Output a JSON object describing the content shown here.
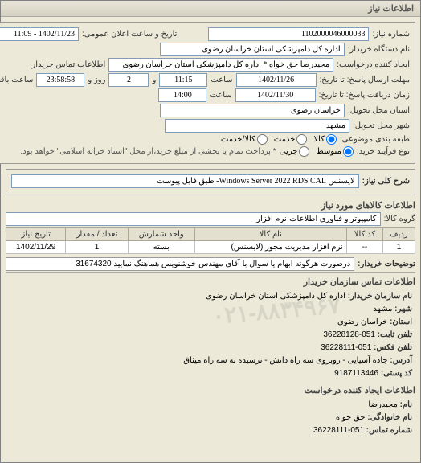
{
  "window_title": "اطلاعات نیاز",
  "fields": {
    "need_no_lbl": "شماره نیاز:",
    "need_no": "1102000046000033",
    "announce_lbl": "تاریخ و ساعت اعلان عمومی:",
    "announce_val": "1402/11/23 - 11:09",
    "buyer_org_lbl": "نام دستگاه خریدار:",
    "buyer_org": "اداره کل دامپزشکی استان خراسان رضوی",
    "creator_lbl": "ایجاد کننده درخواست:",
    "creator": "مجیدرضا حق خواه * اداره کل دامپزشکی استان خراسان رضوی",
    "contact_link": "اطلاعات تماس خریدار",
    "deadline_send_lbl": "مهلت ارسال پاسخ: تا تاریخ:",
    "deadline_date": "1402/11/26",
    "time_lbl": "ساعت",
    "deadline_time": "11:15",
    "and_lbl": "و",
    "days_remain": "2",
    "days_lbl": "روز و",
    "hms_remain": "23:58:58",
    "remain_lbl": "ساعت باقی مانده",
    "receive_lbl": "زمان دریافت پاسخ: تا تاریخ:",
    "receive_date": "1402/11/30",
    "receive_time": "14:00",
    "province_lbl": "استان محل تحویل:",
    "province": "خراسان رضوی",
    "city_lbl": "شهر محل تحویل:",
    "city": "مشهد",
    "category_lbl": "طبقه بندی موضوعی:",
    "cat_opts": {
      "goods": "کالا",
      "service": "خدمت",
      "both": "کالا/خدمت"
    },
    "purchase_type_lbl": "نوع فرآیند خرید:",
    "pt_opts": {
      "medium": "متوسط",
      "minor": "جزیی"
    },
    "purchase_note": "* پرداخت تمام یا بخشی از مبلغ خرید،از محل \"اسناد خزانه اسلامی\" خواهد بود.",
    "need_desc_lbl": "شرح کلی نیاز:",
    "need_desc": "لایسنس Windows Server 2022 RDS CAL- طبق فایل پیوست",
    "goods_hdr": "اطلاعات کالاهای مورد نیاز",
    "goods_group_lbl": "گروه کالا:",
    "goods_group": "کامپیوتر و فناوری اطلاعات-نرم افزار",
    "table": {
      "headers": [
        "ردیف",
        "کد کالا",
        "نام کالا",
        "واحد شمارش",
        "تعداد / مقدار",
        "تاریخ نیاز"
      ],
      "row": [
        "1",
        "--",
        "نرم افزار مدیریت مجوز (لایسنس)",
        "بسته",
        "1",
        "1402/11/29"
      ]
    },
    "buyer_notes_lbl": "توضیحات خریدار:",
    "buyer_notes": "درصورت هرگونه ابهام یا سوال با آقای مهندس خوشنویس هماهنگ نمایید 31674320",
    "org_contact_hdr": "اطلاعات تماس سازمان خریدار",
    "org_name_lbl": "نام سازمان خریدار:",
    "org_name": "اداره کل دامپزشکی استان خراسان رضوی",
    "org_city_lbl": "شهر:",
    "org_city": "مشهد",
    "org_province_lbl": "استان:",
    "org_province": "خراسان رضوی",
    "org_tel_lbl": "تلفن ثابت:",
    "org_tel": "051-36228128",
    "org_fax_lbl": "تلفن فکس:",
    "org_fax": "051-36228111",
    "org_addr_lbl": "آدرس:",
    "org_addr": "جاده آسیایی - روبروی سه راه دانش - نرسیده به سه راه میثاق",
    "org_post_lbl": "کد پستی:",
    "org_post": "9187113446",
    "req_creator_hdr": "اطلاعات ایجاد کننده درخواست",
    "rc_name_lbl": "نام:",
    "rc_name": "مجیدرضا",
    "rc_family_lbl": "نام خانوادگی:",
    "rc_family": "حق خواه",
    "rc_tel_lbl": "شماره تماس:",
    "rc_tel": "051-36228111",
    "watermark": "۰۲۱-۸۸۳۴۹۶۷"
  }
}
